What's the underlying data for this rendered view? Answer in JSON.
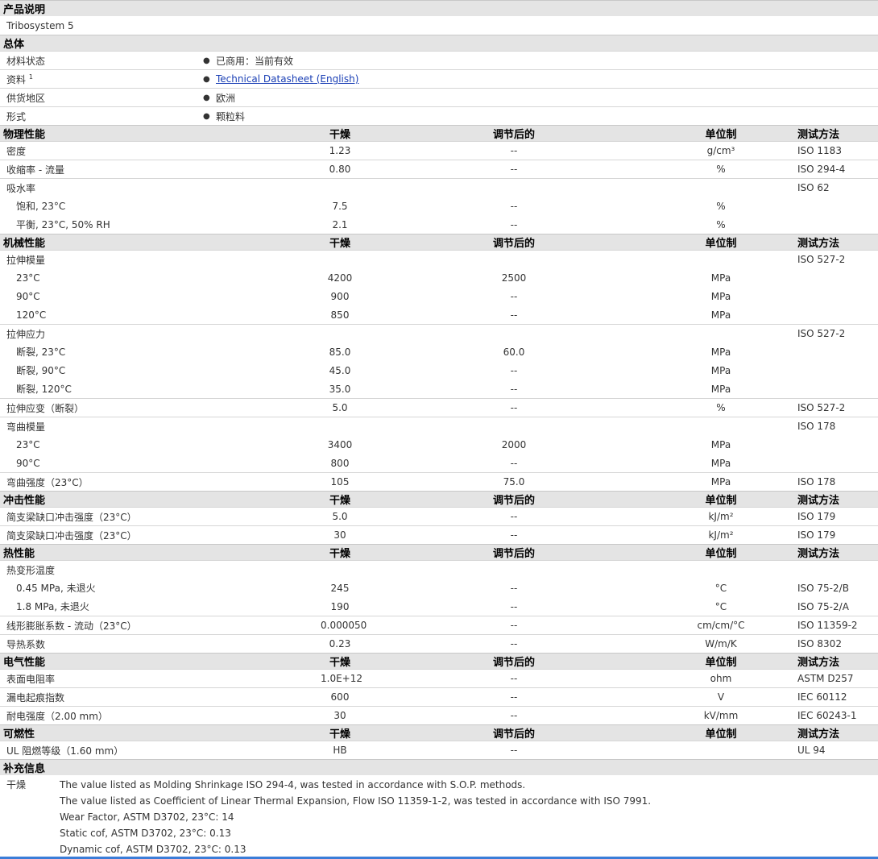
{
  "product": {
    "header": "产品说明",
    "name": "Tribosystem 5"
  },
  "general": {
    "header": "总体",
    "rows": [
      {
        "label": "材料状态",
        "value": "已商用：当前有效"
      },
      {
        "label": "资料",
        "sup": "1",
        "value": "Technical Datasheet (English)"
      },
      {
        "label": "供货地区",
        "value": "欧洲"
      },
      {
        "label": "形式",
        "value": "颗粒料"
      }
    ]
  },
  "columns": {
    "dry": "干燥",
    "cond": "调节后的",
    "unit": "单位制",
    "method": "测试方法"
  },
  "physical": {
    "header": "物理性能",
    "rows": [
      {
        "label": "密度",
        "dry": "1.23",
        "cond": "--",
        "unit": "g/cm³",
        "method": "ISO 1183"
      },
      {
        "label": "收缩率 - 流量",
        "dry": "0.80",
        "cond": "--",
        "unit": "%",
        "method": "ISO 294-4"
      },
      {
        "label": "吸水率",
        "dry": "",
        "cond": "",
        "unit": "",
        "method": "ISO 62"
      },
      {
        "label": "饱和, 23°C",
        "dry": "7.5",
        "cond": "--",
        "unit": "%",
        "method": ""
      },
      {
        "label": "平衡, 23°C, 50% RH",
        "dry": "2.1",
        "cond": "--",
        "unit": "%",
        "method": ""
      }
    ]
  },
  "mechanical": {
    "header": "机械性能",
    "rows": [
      {
        "label": "拉伸模量",
        "dry": "",
        "cond": "",
        "unit": "",
        "method": "ISO 527-2"
      },
      {
        "label": "23°C",
        "dry": "4200",
        "cond": "2500",
        "unit": "MPa",
        "method": ""
      },
      {
        "label": "90°C",
        "dry": "900",
        "cond": "--",
        "unit": "MPa",
        "method": ""
      },
      {
        "label": "120°C",
        "dry": "850",
        "cond": "--",
        "unit": "MPa",
        "method": ""
      },
      {
        "label": "拉伸应力",
        "dry": "",
        "cond": "",
        "unit": "",
        "method": "ISO 527-2"
      },
      {
        "label": "断裂, 23°C",
        "dry": "85.0",
        "cond": "60.0",
        "unit": "MPa",
        "method": ""
      },
      {
        "label": "断裂, 90°C",
        "dry": "45.0",
        "cond": "--",
        "unit": "MPa",
        "method": ""
      },
      {
        "label": "断裂, 120°C",
        "dry": "35.0",
        "cond": "--",
        "unit": "MPa",
        "method": ""
      },
      {
        "label": "拉伸应变（断裂）",
        "dry": "5.0",
        "cond": "--",
        "unit": "%",
        "method": "ISO 527-2"
      },
      {
        "label": "弯曲模量",
        "dry": "",
        "cond": "",
        "unit": "",
        "method": "ISO 178"
      },
      {
        "label": "23°C",
        "dry": "3400",
        "cond": "2000",
        "unit": "MPa",
        "method": ""
      },
      {
        "label": "90°C",
        "dry": "800",
        "cond": "--",
        "unit": "MPa",
        "method": ""
      },
      {
        "label": "弯曲强度（23°C）",
        "dry": "105",
        "cond": "75.0",
        "unit": "MPa",
        "method": "ISO 178"
      }
    ]
  },
  "impact": {
    "header": "冲击性能",
    "rows": [
      {
        "label": "简支梁缺口冲击强度（23°C）",
        "dry": "5.0",
        "cond": "--",
        "unit": "kJ/m²",
        "method": "ISO 179"
      },
      {
        "label": "简支梁缺口冲击强度（23°C）",
        "dry": "30",
        "cond": "--",
        "unit": "kJ/m²",
        "method": "ISO 179"
      }
    ]
  },
  "thermal": {
    "header": "热性能",
    "rows": [
      {
        "label": "热变形温度",
        "dry": "",
        "cond": "",
        "unit": "",
        "method": ""
      },
      {
        "label": "0.45 MPa, 未退火",
        "dry": "245",
        "cond": "--",
        "unit": "°C",
        "method": "ISO 75-2/B"
      },
      {
        "label": "1.8 MPa, 未退火",
        "dry": "190",
        "cond": "--",
        "unit": "°C",
        "method": "ISO 75-2/A"
      },
      {
        "label": "线形膨胀系数 - 流动（23°C）",
        "dry": "0.000050",
        "cond": "--",
        "unit": "cm/cm/°C",
        "method": "ISO 11359-2"
      },
      {
        "label": "导热系数",
        "dry": "0.23",
        "cond": "--",
        "unit": "W/m/K",
        "method": "ISO 8302"
      }
    ]
  },
  "electrical": {
    "header": "电气性能",
    "rows": [
      {
        "label": "表面电阻率",
        "dry": "1.0E+12",
        "cond": "--",
        "unit": "ohm",
        "method": "ASTM D257"
      },
      {
        "label": "漏电起痕指数",
        "dry": "600",
        "cond": "--",
        "unit": "V",
        "method": "IEC 60112"
      },
      {
        "label": "耐电强度（2.00 mm）",
        "dry": "30",
        "cond": "--",
        "unit": "kV/mm",
        "method": "IEC 60243-1"
      }
    ]
  },
  "flammability": {
    "header": "可燃性",
    "rows": [
      {
        "label": "UL 阻燃等级（1.60 mm）",
        "dry": "HB",
        "cond": "--",
        "unit": "",
        "method": "UL 94"
      }
    ]
  },
  "supplement": {
    "header": "补充信息",
    "label": "干燥",
    "lines": [
      "The value listed as Molding Shrinkage ISO 294-4, was tested in accordance with S.O.P. methods.",
      "The value listed as Coefficient of Linear Thermal Expansion, Flow ISO 11359-1-2, was tested in accordance with ISO 7991.",
      "Wear Factor, ASTM D3702, 23°C: 14",
      "Static cof, ASTM D3702, 23°C: 0.13",
      "Dynamic cof, ASTM D3702, 23°C: 0.13"
    ]
  }
}
